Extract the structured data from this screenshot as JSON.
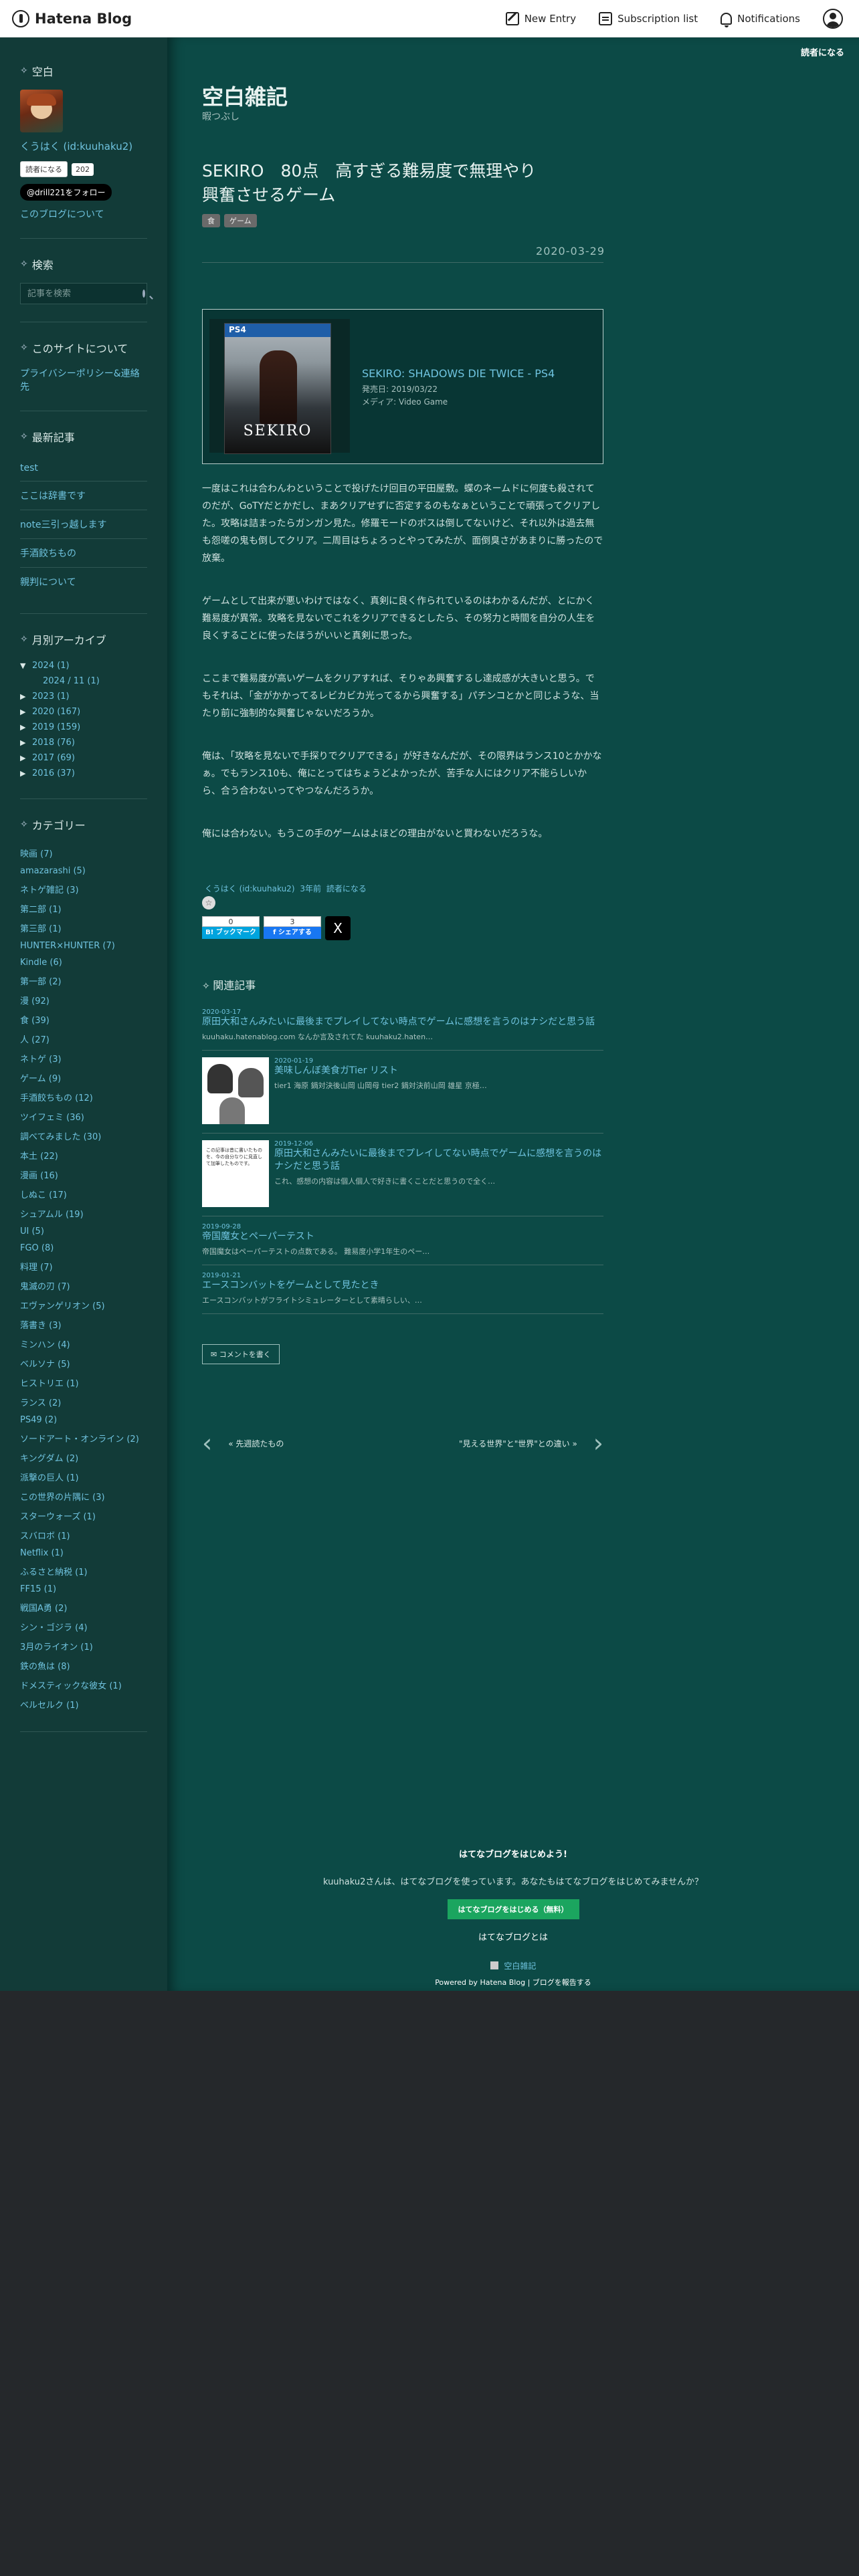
{
  "topbar": {
    "brand": "Hatena Blog",
    "new_entry": "New Entry",
    "subscription": "Subscription list",
    "notifications": "Notifications"
  },
  "reader_mode": "読者になる",
  "sidebar": {
    "profile": {
      "title": "空白",
      "name": "くうはく (id:kuuhaku2)",
      "reader_button": "読者になる",
      "reader_count": "202",
      "x_follow": "@drill221をフォロー",
      "about_link": "このブログについて"
    },
    "search": {
      "title": "検索",
      "placeholder": "記事を検索"
    },
    "about_site": {
      "title": "このサイトについて",
      "link": "プライバシーポリシー&連絡先"
    },
    "recent": {
      "title": "最新記事",
      "items": [
        "test",
        "ここは辞書です",
        "note三引っ越します",
        "手酒餃ちもの",
        "親判について"
      ]
    },
    "archive": {
      "title": "月別アーカイブ",
      "rows": [
        {
          "toggle": "▼",
          "label": "2024 (1)"
        },
        {
          "toggle": "",
          "label": "2024 / 11 (1)"
        },
        {
          "toggle": "▶",
          "label": "2023 (1)"
        },
        {
          "toggle": "▶",
          "label": "2020 (167)"
        },
        {
          "toggle": "▶",
          "label": "2019 (159)"
        },
        {
          "toggle": "▶",
          "label": "2018 (76)"
        },
        {
          "toggle": "▶",
          "label": "2017 (69)"
        },
        {
          "toggle": "▶",
          "label": "2016 (37)"
        }
      ]
    },
    "categories": {
      "title": "カテゴリー",
      "items": [
        "映画 (7)",
        "amazarashi (5)",
        "ネトゲ雑記 (3)",
        "第二部 (1)",
        "第三部 (1)",
        "HUNTER×HUNTER (7)",
        "Kindle (6)",
        "第一部 (2)",
        "漫 (92)",
        "食 (39)",
        "人 (27)",
        "ネトゲ (3)",
        "ゲーム (9)",
        "手酒餃ちもの (12)",
        "ツイフェミ (36)",
        "調べてみました (30)",
        "本土 (22)",
        "漫画 (16)",
        "しぬこ (17)",
        "シュアムル (19)",
        "UI (5)",
        "FGO (8)",
        "料理 (7)",
        "鬼滅の刃 (7)",
        "エヴァンゲリオン (5)",
        "落書き (3)",
        "ミンハン (4)",
        "ベルソナ (5)",
        "ヒストリエ (1)",
        "ランス (2)",
        "PS49 (2)",
        "ソードアート・オンライン (2)",
        "キングダム (2)",
        "派撃の巨人 (1)",
        "この世界の片隅に (3)",
        "スターウォーズ (1)",
        "スバロボ (1)",
        "Netflix (1)",
        "ふるさと納税 (1)",
        "FF15 (1)",
        "戦国A勇 (2)",
        "シン・ゴジラ (4)",
        "3月のライオン (1)",
        "鉄の魚は (8)",
        "ドメスティックな彼女 (1)",
        "ベルセルク (1)"
      ]
    }
  },
  "main": {
    "blog_title": "空白雑記",
    "blog_desc": "暇つぶし",
    "entry": {
      "title": "SEKIRO　80点　高すぎる難易度で無理やり興奮させるゲーム",
      "categories": [
        "食",
        "ゲーム"
      ],
      "date": "2020-03-29",
      "product": {
        "box_band": "PS4",
        "box_logo": "SEKIRO",
        "name": "SEKIRO: SHADOWS DIE TWICE - PS4",
        "release": "発売日: 2019/03/22",
        "media": "メディア: Video Game"
      },
      "paragraphs": [
        "一度はこれは合わんわということで投げたけ回目の平田屋敷。蝶のネームドに何度も殺されてのだが、GoTYだとかだし、まあクリアせずに否定するのもなぁということで頑張ってクリアした。攻略は詰まったらガンガン見た。修羅モードのボスは倒してないけど、それ以外は過去無も怨嗟の鬼も倒してクリア。二周目はちょろっとやってみたが、面倒臭さがあまりに勝ったので放棄。",
        "ゲームとして出来が悪いわけではなく、真剣に良く作られているのはわかるんだが、とにかく難易度が異常。攻略を見ないでこれをクリアできるとしたら、その努力と時間を自分の人生を良くすることに使ったほうがいいと真剣に思った。",
        "ここまで難易度が高いゲームをクリアすれば、そりゃあ興奮するし達成感が大きいと思う。でもそれは、「金がかかってるレビカビカ光ってるから興奮する」パチンコとかと同じような、当たり前に強制的な興奮じゃないだろうか。",
        "俺は、「攻略を見ないで手探りでクリアできる」が好きなんだが、その限界はランス10とかかなぁ。でもランス10も、俺にとってはちょうどよかったが、苦手な人にはクリア不能らしいから、合う合わないってやつなんだろうか。",
        "俺には合わない。もうこの手のゲームはよほどの理由がないと買わないだろうな。"
      ],
      "author": "くうはく (id:kuuhaku2)",
      "author_time": "3年前",
      "read_more": "読者になる",
      "star": "☆",
      "hatebu_count": "0",
      "hatebu_label": "B! ブックマーク",
      "fb_count": "3",
      "fb_label": "f シェアする",
      "x_label": "X"
    },
    "related": {
      "title": "関連記事",
      "items": [
        {
          "date": "2020-03-17",
          "title": "原田大和さんみたいに最後までプレイしてない時点でゲームに感想を言うのはナシだと思う話",
          "snippet": "kuuhaku.hatenablog.com なんか言及されてた kuuhaku2.haten…",
          "thumb": ""
        },
        {
          "date": "2020-01-19",
          "title": "美味しんぼ美食ガTier リスト",
          "snippet": "tier1 海原 鍋対決後山岡 山岡母 tier2 鍋対決前山岡 雄星 京極…",
          "thumb": "manga"
        },
        {
          "date": "2019-12-06",
          "title": "原田大和さんみたいに最後までプレイしてない時点でゲームに感想を言うのはナシだと思う話",
          "snippet": "これ、感想の内容は個人個人で好きに書くことだと思うので全く…",
          "thumb": "text"
        },
        {
          "date": "2019-09-28",
          "title": "帝国魔女とペーパーテスト",
          "snippet": "帝国魔女はペーパーテストの点数である。 難易度小学1年生のペー…",
          "thumb": ""
        },
        {
          "date": "2019-01-21",
          "title": "エースコンバットをゲームとして見たとき",
          "snippet": "エースコンバットがフライトシミュレーターとして素晴らしい、…",
          "thumb": ""
        }
      ],
      "thumb_text": "この記事は昔に書いたものを、今の自分なりに見直して加筆したものです。"
    },
    "comment_button": "コメントを書く",
    "pager": {
      "prev": "« 先週読たもの",
      "next": "\"見える世界\"と\"世界\"との違い »"
    },
    "footer": {
      "title": "はてなブログをはじめよう!",
      "desc": "kuuhaku2さんは、はてなブログを使っています。あなたもはてなブログをはじめてみませんか？",
      "cta": "はてなブログをはじめる（無料）",
      "about": "はてなブログとは",
      "blog_name": "空白雑記",
      "powered_prefix": "Powered by",
      "powered_link": "Hatena Blog",
      "report": "ブログを報告する"
    }
  }
}
